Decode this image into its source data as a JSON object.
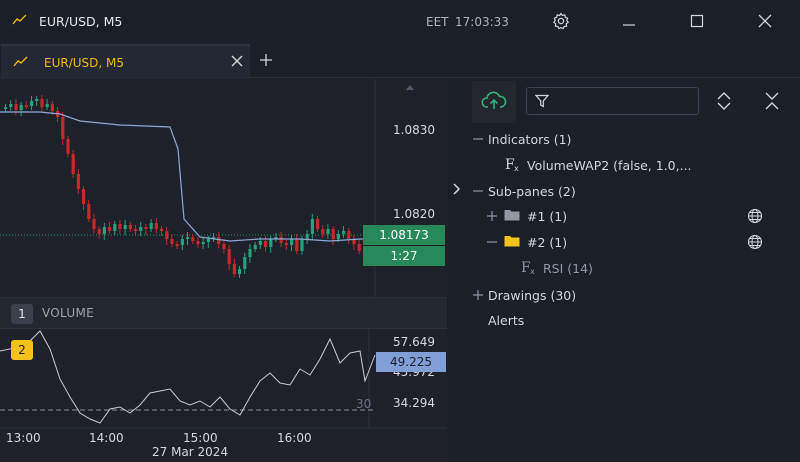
{
  "window": {
    "title": "EUR/USD, M5",
    "timezone": "EET",
    "time": "17:03:33"
  },
  "tab": {
    "label": "EUR/USD, M5"
  },
  "chart": {
    "price_labels": [
      "1.0830",
      "1.0820"
    ],
    "current_price": "1.08173",
    "countdown": "1:27",
    "pane1_badge": "1",
    "pane1_label": "VOLUME",
    "pane2_badge": "2",
    "rsi_labels": [
      "57.649",
      "45.972",
      "34.294"
    ],
    "rsi_current": "49.225",
    "rsi_level": "30",
    "time_labels": [
      "13:00",
      "14:00",
      "15:00",
      "16:00"
    ],
    "date_label": "27 Mar 2024",
    "colors": {
      "up": "#26a17b",
      "down": "#c6282b",
      "vwap": "#8ea7d8",
      "rsi": "#c9ccd2",
      "accent": "#f0b90b"
    }
  },
  "panel": {
    "filter_placeholder": "",
    "tree": {
      "indicators": "Indicators (1)",
      "indicator_item": "VolumeWAP2 (false, 1.0,...",
      "subpanes": "Sub-panes (2)",
      "subpane1": "#1 (1)",
      "subpane2": "#2 (1)",
      "rsi": "RSI (14)",
      "drawings": "Drawings (30)",
      "alerts": "Alerts"
    }
  },
  "icons": [
    "chart-line-icon",
    "gear-icon",
    "minimize-icon",
    "maximize-icon",
    "close-icon",
    "plus-icon",
    "cloud-upload-icon",
    "filter-icon",
    "expand-collapse-icon",
    "collapse-all-icon",
    "folder-icon",
    "globe-icon",
    "function-icon",
    "chevron-right-icon",
    "chevron-up-icon"
  ]
}
